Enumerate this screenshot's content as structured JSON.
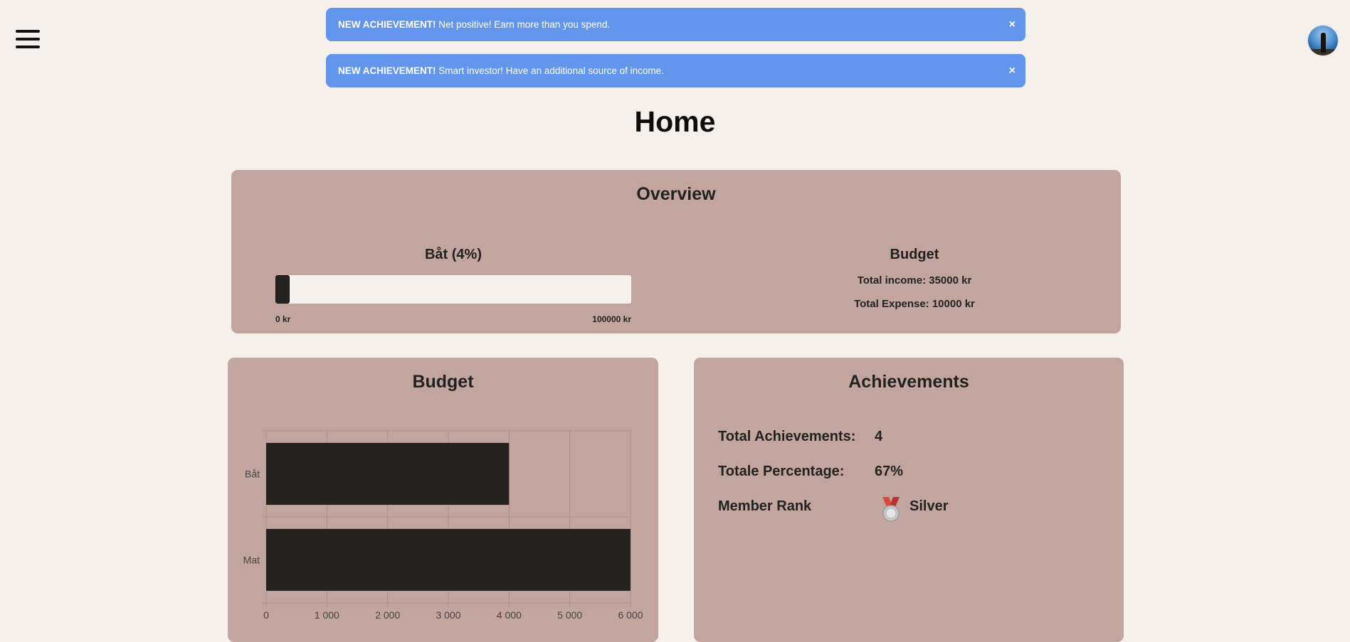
{
  "header": {
    "menu_icon": "hamburger-menu-icon",
    "avatar_icon": "user-avatar-icon"
  },
  "alerts": [
    {
      "prefix": "NEW ACHIEVEMENT!",
      "message": "Net positive! Earn more than you spend.",
      "close": "×"
    },
    {
      "prefix": "NEW ACHIEVEMENT!",
      "message": "Smart investor! Have an additional source of income.",
      "close": "×"
    }
  ],
  "page_title": "Home",
  "overview": {
    "title": "Overview",
    "goal_label": "Båt (4%)",
    "goal_progress": 0.04,
    "goal_min": "0 kr",
    "goal_max": "100000 kr",
    "budget_title": "Budget",
    "total_income": "Total income: 35000 kr",
    "total_expense": "Total Expense: 10000 kr"
  },
  "budget_card": {
    "title": "Budget"
  },
  "chart_data": {
    "type": "bar",
    "orientation": "horizontal",
    "categories": [
      "Båt",
      "Mat"
    ],
    "values": [
      4000,
      6000
    ],
    "xlim": [
      0,
      6000
    ],
    "xticks": [
      "0",
      "1 000",
      "2 000",
      "3 000",
      "4 000",
      "5 000",
      "6 000"
    ],
    "grid": true,
    "bar_color": "#262220"
  },
  "achievements": {
    "title": "Achievements",
    "total_label": "Total Achievements:",
    "total_value": "4",
    "percentage_label": "Totale Percentage:",
    "percentage_value": "67%",
    "rank_label": "Member Rank",
    "rank_value": "Silver",
    "rank_icon": "silver-medal-icon"
  },
  "colors": {
    "background": "#f6f0ed",
    "card": "#c3a59f",
    "alert": "#6495ed",
    "bar": "#262220"
  }
}
